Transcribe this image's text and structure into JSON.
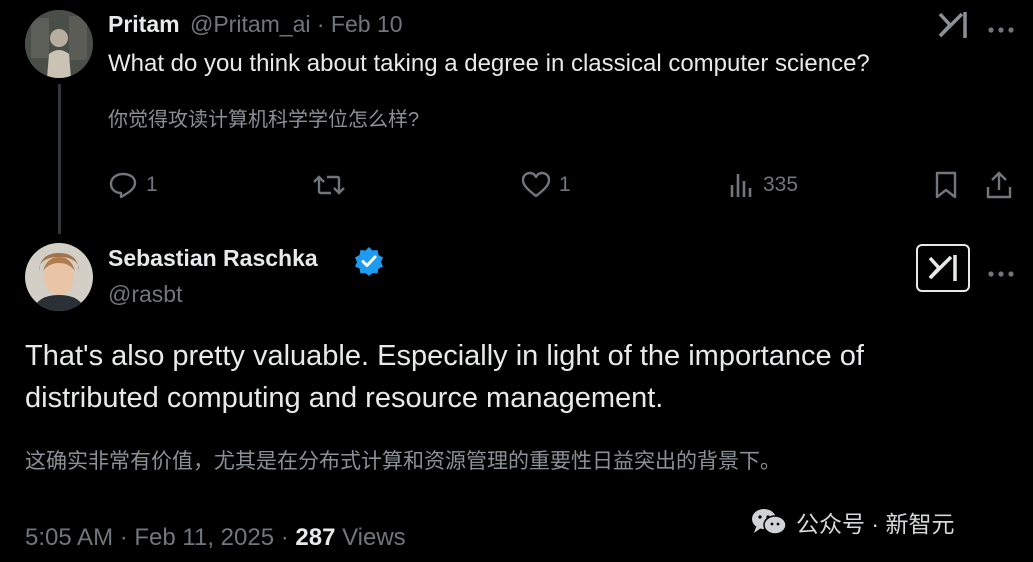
{
  "parent_tweet": {
    "author_name": "Pritam",
    "handle_date": "@Pritam_ai · Feb 10",
    "text": "What do you think about taking a degree in classical computer science?",
    "translation": "你觉得攻读计算机科学学位怎么样?",
    "actions": {
      "reply_count": "1",
      "retweet_count": "",
      "like_count": "1",
      "views_count": "335"
    }
  },
  "main_tweet": {
    "author_name": "Sebastian Raschka",
    "handle": "@rasbt",
    "text_line1": "That's also pretty valuable. Especially in light of the importance of",
    "text_line2": "distributed computing and resource management.",
    "translation": "这确实非常有价值，尤其是在分布式计算和资源管理的重要性日益突出的背景下。",
    "timestamp": "5:05 AM · Feb 11, 2025 · ",
    "views_count": "287",
    "views_label": " Views"
  },
  "watermark": {
    "text": "公众号 · 新智元"
  },
  "colors": {
    "background": "#000000",
    "text_primary": "#e7e9ea",
    "text_secondary": "#71767b",
    "verified_blue": "#1d9bf0"
  }
}
